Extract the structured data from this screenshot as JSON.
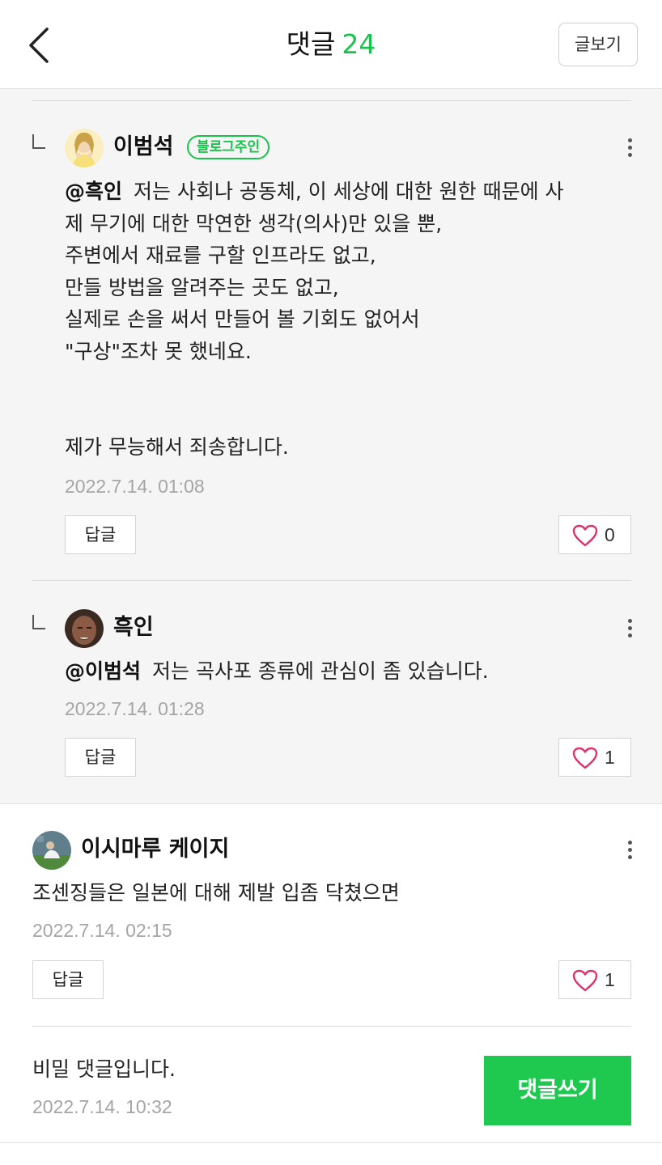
{
  "header": {
    "back_icon": "chevron-left-icon",
    "title": "댓글",
    "count": "24",
    "view_post_label": "글보기"
  },
  "colors": {
    "accent": "#19c34b",
    "reply_background": "#f5f5f5",
    "heart": "#e0306a"
  },
  "replies": [
    {
      "author": "이범석",
      "badge": "블로그주인",
      "mention": "@흑인",
      "text": "저는 사회나 공동체, 이 세상에 대한 원한 때문에 사\n제 무기에 대한 막연한 생각(의사)만 있을 뿐,\n주변에서 재료를 구할 인프라도 없고,\n만들 방법을 알려주는 곳도 없고,\n실제로 손을 써서 만들어 볼 기회도 없어서\n\"구상\"조차 못 했네요.\n\n\n제가 무능해서 죄송합니다.",
      "date": "2022.7.14. 01:08",
      "reply_label": "답글",
      "likes": "0"
    },
    {
      "author": "흑인",
      "mention": "@이범석",
      "text": "저는 곡사포 종류에 관심이 좀 있습니다.",
      "date": "2022.7.14. 01:28",
      "reply_label": "답글",
      "likes": "1"
    }
  ],
  "comment": {
    "author": "이시마루 케이지",
    "text": "조센징들은 일본에 대해 제발 입좀 닥쳤으면",
    "date": "2022.7.14. 02:15",
    "reply_label": "답글",
    "likes": "1"
  },
  "secret_comment": {
    "text": "비밀 댓글입니다.",
    "date": "2022.7.14. 10:32"
  },
  "write_button_label": "댓글쓰기"
}
